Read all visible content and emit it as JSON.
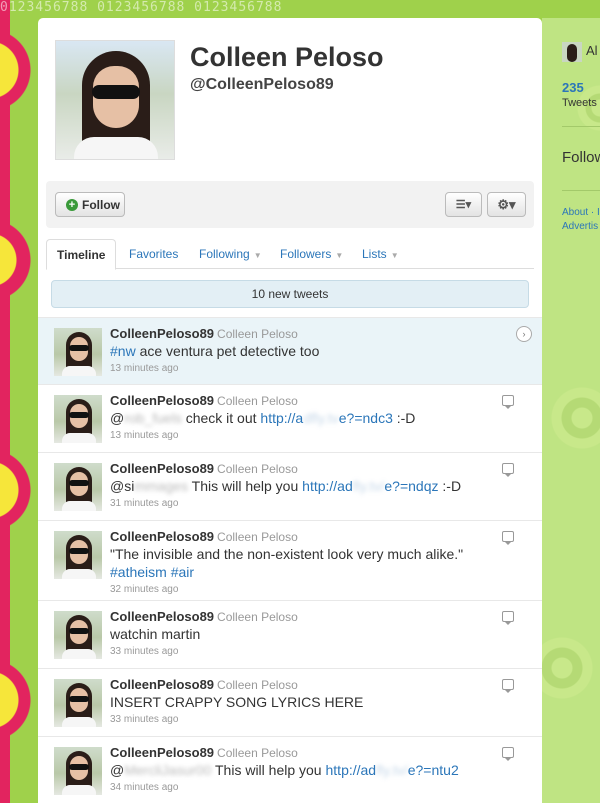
{
  "background": {
    "digits": "0123456788         0123456788         0123456788"
  },
  "profile": {
    "name": "Colleen Peloso",
    "handle": "@ColleenPeloso89"
  },
  "actions": {
    "follow_label": "Follow",
    "list_icon": "list-icon",
    "gear_icon": "gear-icon"
  },
  "tabs": [
    {
      "label": "Timeline",
      "active": true
    },
    {
      "label": "Favorites"
    },
    {
      "label": "Following"
    },
    {
      "label": "Followers"
    },
    {
      "label": "Lists"
    }
  ],
  "new_tweets_label": "10 new tweets",
  "tweets": [
    {
      "user": "ColleenPeloso89",
      "full": "Colleen Peloso",
      "time": "13 minutes ago",
      "parts": [
        {
          "t": "#nw",
          "link": true
        },
        {
          "t": " ace ventura pet detective too"
        }
      ]
    },
    {
      "user": "ColleenPeloso89",
      "full": "Colleen Peloso",
      "time": "13 minutes ago",
      "parts": [
        {
          "t": "@"
        },
        {
          "t": "rob_fuels",
          "blurdark": true
        },
        {
          "t": " check it out "
        },
        {
          "t": "http://a",
          "link": true
        },
        {
          "t": "dfly.tv",
          "blur": true
        },
        {
          "t": "e?=ndc3",
          "link": true
        },
        {
          "t": " :-D"
        }
      ]
    },
    {
      "user": "ColleenPeloso89",
      "full": "Colleen Peloso",
      "time": "31 minutes ago",
      "parts": [
        {
          "t": "@si"
        },
        {
          "t": "mmages",
          "blurdark": true
        },
        {
          "t": " This will help you "
        },
        {
          "t": "http://ad",
          "link": true
        },
        {
          "t": "fly.tv/",
          "blur": true
        },
        {
          "t": "e?=ndqz",
          "link": true
        },
        {
          "t": " :-D"
        }
      ]
    },
    {
      "user": "ColleenPeloso89",
      "full": "Colleen Peloso",
      "time": "32 minutes ago",
      "parts": [
        {
          "t": "\"The invisible and the non-existent look very much alike.\" "
        },
        {
          "t": "#atheism",
          "link": true
        },
        {
          "t": " "
        },
        {
          "t": "#air",
          "link": true
        }
      ]
    },
    {
      "user": "ColleenPeloso89",
      "full": "Colleen Peloso",
      "time": "33 minutes ago",
      "parts": [
        {
          "t": "watchin martin"
        }
      ]
    },
    {
      "user": "ColleenPeloso89",
      "full": "Colleen Peloso",
      "time": "33 minutes ago",
      "parts": [
        {
          "t": "INSERT CRAPPY SONG LYRICS HERE"
        }
      ]
    },
    {
      "user": "ColleenPeloso89",
      "full": "Colleen Peloso",
      "time": "34 minutes ago",
      "parts": [
        {
          "t": "@"
        },
        {
          "t": "MercliJasur00",
          "blurdark": true
        },
        {
          "t": " This will help you "
        },
        {
          "t": "http://ad",
          "link": true
        },
        {
          "t": "fly.tv/",
          "blur": true
        },
        {
          "t": "e?=ntu2",
          "link": true
        }
      ]
    }
  ],
  "sidebar": {
    "name": "Al",
    "count": "235",
    "tweets_label": "Tweets",
    "follow_label": "Follow",
    "footer1": "About · I",
    "footer2": "Advertis"
  }
}
